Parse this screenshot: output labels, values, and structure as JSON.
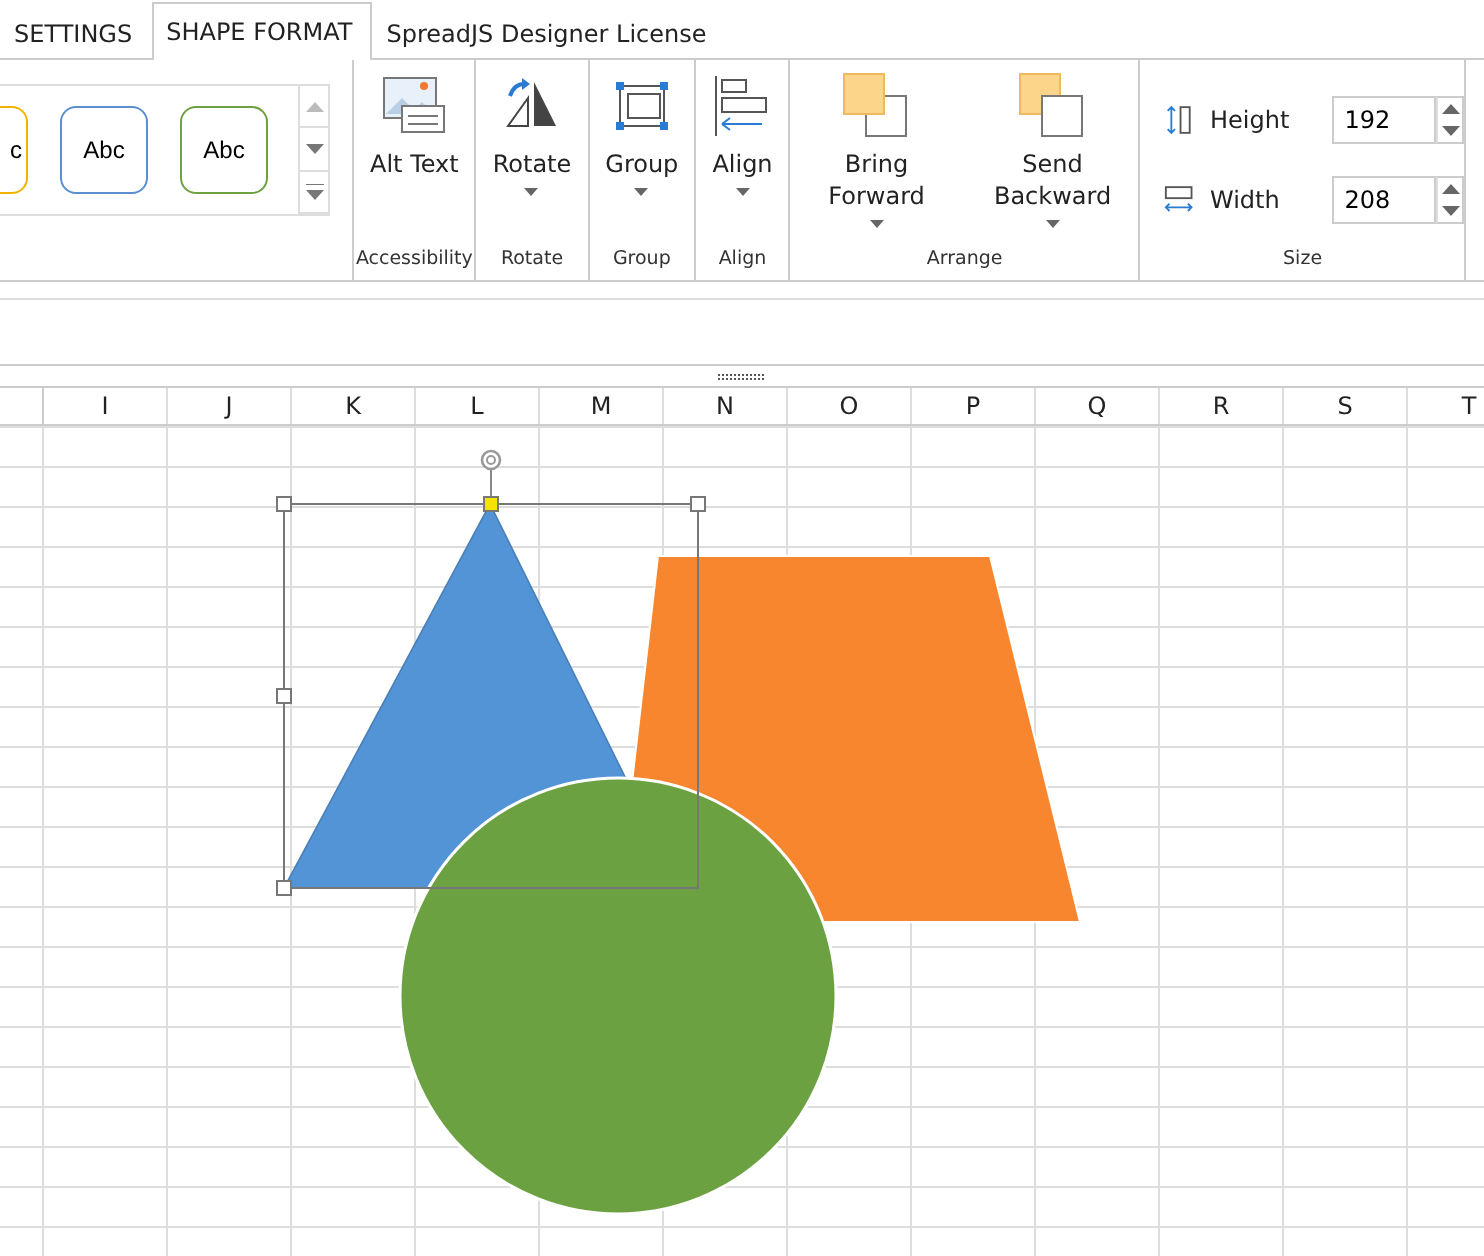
{
  "tabs": [
    {
      "label": "SETTINGS",
      "selected": false
    },
    {
      "label": "SHAPE FORMAT",
      "selected": true
    },
    {
      "label": "SpreadJS Designer License",
      "selected": false
    }
  ],
  "style_gallery": [
    {
      "label": "c",
      "color": "#f0b400"
    },
    {
      "label": "Abc",
      "color": "#5b8fcf"
    },
    {
      "label": "Abc",
      "color": "#70a040"
    }
  ],
  "groups": [
    {
      "label": "Accessibility",
      "buttons": [
        {
          "label": "Alt Text",
          "dropdown": false
        }
      ]
    },
    {
      "label": "Rotate",
      "buttons": [
        {
          "label": "Rotate",
          "dropdown": true
        }
      ]
    },
    {
      "label": "Group",
      "buttons": [
        {
          "label": "Group",
          "dropdown": true
        }
      ]
    },
    {
      "label": "Align",
      "buttons": [
        {
          "label": "Align",
          "dropdown": true
        }
      ]
    },
    {
      "label": "Arrange",
      "buttons": [
        {
          "label": "Bring Forward",
          "dropdown": true
        },
        {
          "label": "Send Backward",
          "dropdown": true
        }
      ]
    }
  ],
  "size": {
    "label": "Size",
    "fields": [
      {
        "label": "Height",
        "value": "192"
      },
      {
        "label": "Width",
        "value": "208"
      }
    ]
  },
  "columns": [
    "I",
    "J",
    "K",
    "L",
    "M",
    "N",
    "O",
    "P",
    "Q",
    "R",
    "S",
    "T"
  ],
  "shapes": [
    {
      "kind": "triangle",
      "color": "#5394d6",
      "selected": true
    },
    {
      "kind": "trapezoid",
      "color": "#f8862e",
      "selected": false
    },
    {
      "kind": "circle",
      "color": "#6ca142",
      "selected": false
    }
  ]
}
